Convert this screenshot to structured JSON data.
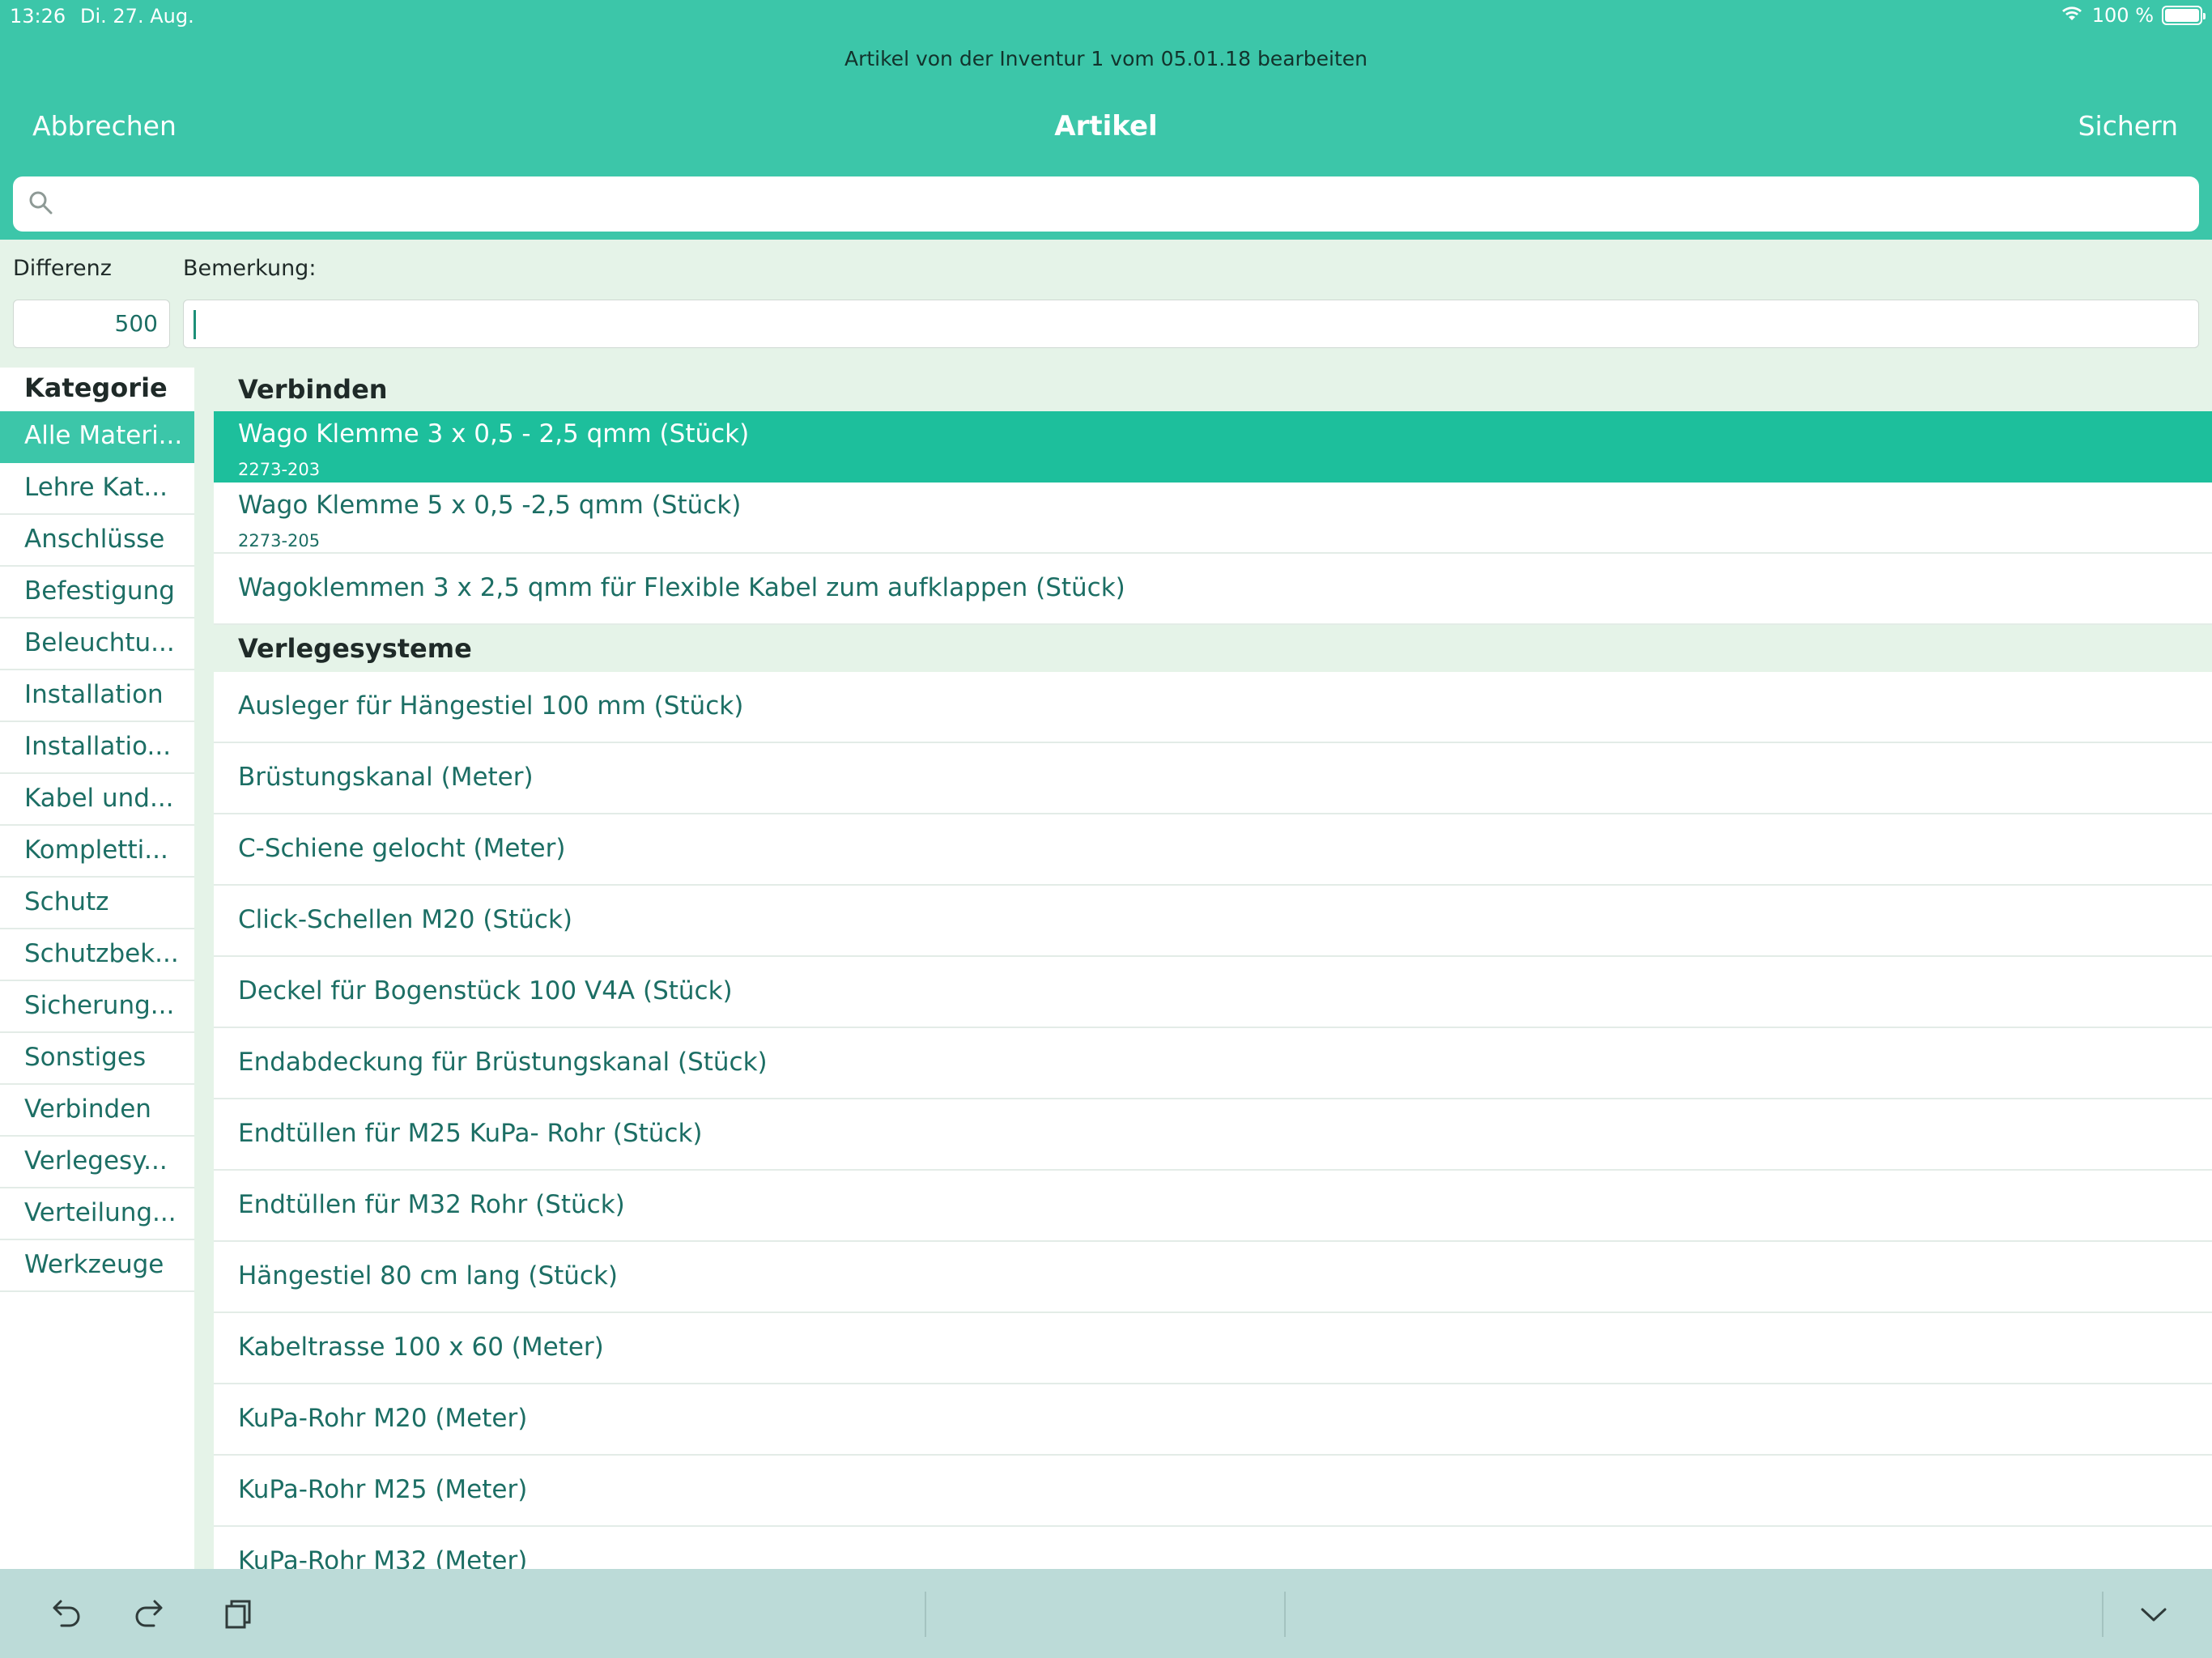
{
  "status_bar": {
    "time": "13:26",
    "date": "Di. 27. Aug.",
    "battery_text": "100 %",
    "wifi_icon": "wifi-icon",
    "battery_icon": "battery-icon"
  },
  "header": {
    "subtitle": "Artikel von der Inventur 1 vom 05.01.18 bearbeiten",
    "title": "Artikel",
    "cancel_label": "Abbrechen",
    "save_label": "Sichern",
    "accent_color": "#3cc6a9"
  },
  "search": {
    "placeholder": "",
    "value": ""
  },
  "form": {
    "difference_label": "Differenz",
    "difference_value": "500",
    "remark_label": "Bemerkung:",
    "remark_value": ""
  },
  "categories": {
    "header": "Kategorie",
    "items": [
      "Alle Materi...",
      "Lehre Kat...",
      "Anschlüsse",
      "Befestigung",
      "Beleuchtu...",
      "Installation",
      "Installatio...",
      "Kabel und...",
      "Kompletti...",
      "Schutz",
      "Schutzbek...",
      "Sicherung...",
      "Sonstiges",
      "Verbinden",
      "Verlegesy...",
      "Verteilung...",
      "Werkzeuge"
    ],
    "selected_index": 0
  },
  "articles": {
    "sections": [
      {
        "title": "Verbinden",
        "items": [
          {
            "title": "Wago Klemme 3 x 0,5 - 2,5 qmm (Stück)",
            "sub": "2273-203",
            "selected": true
          },
          {
            "title": "Wago Klemme 5 x 0,5 -2,5 qmm (Stück)",
            "sub": "2273-205",
            "selected": false
          },
          {
            "title": "Wagoklemmen 3 x 2,5 qmm für Flexible Kabel zum aufklappen (Stück)",
            "sub": "",
            "selected": false
          }
        ]
      },
      {
        "title": "Verlegesysteme",
        "items": [
          {
            "title": "Ausleger für Hängestiel 100 mm (Stück)",
            "sub": ""
          },
          {
            "title": "Brüstungskanal (Meter)",
            "sub": ""
          },
          {
            "title": "C-Schiene gelocht (Meter)",
            "sub": ""
          },
          {
            "title": "Click-Schellen M20 (Stück)",
            "sub": ""
          },
          {
            "title": "Deckel für Bogenstück 100 V4A (Stück)",
            "sub": ""
          },
          {
            "title": "Endabdeckung für Brüstungskanal (Stück)",
            "sub": ""
          },
          {
            "title": "Endtüllen für M25 KuPa- Rohr (Stück)",
            "sub": ""
          },
          {
            "title": "Endtüllen für M32 Rohr (Stück)",
            "sub": ""
          },
          {
            "title": "Hängestiel 80 cm lang (Stück)",
            "sub": ""
          },
          {
            "title": "Kabeltrasse 100 x 60 (Meter)",
            "sub": ""
          },
          {
            "title": "KuPa-Rohr M20 (Meter)",
            "sub": ""
          },
          {
            "title": "KuPa-Rohr M25 (Meter)",
            "sub": ""
          },
          {
            "title": "KuPa-Rohr M32 (Meter)",
            "sub": ""
          }
        ]
      }
    ]
  },
  "toolbar": {
    "undo_icon": "undo-icon",
    "redo_icon": "redo-icon",
    "paste_icon": "paste-icon",
    "dismiss_icon": "chevron-down-icon"
  }
}
